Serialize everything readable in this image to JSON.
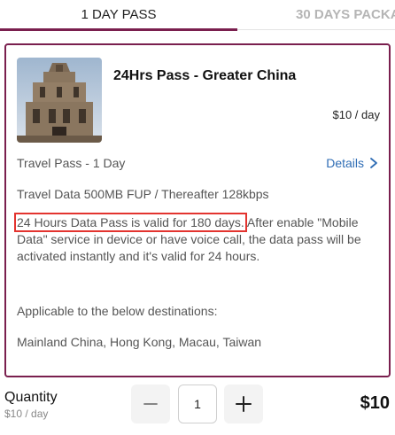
{
  "tabs": [
    {
      "label": "1 DAY PASS"
    },
    {
      "label": "30 DAYS PACKA"
    }
  ],
  "card": {
    "title": "24Hrs Pass - Greater China",
    "price_per_day": "$10 / day",
    "pass_type": "Travel Pass - 1 Day",
    "details_label": "Details",
    "data_line": "Travel Data 500MB FUP / Thereafter 128kbps",
    "validity_highlight": "24 Hours Data Pass is valid for 180 days.",
    "validity_rest": " After enable \"Mobile Data\" service in device or have voice call, the data pass will be activated instantly and it's valid for 24 hours.",
    "applicable": "Applicable to the below destinations:",
    "destinations": "Mainland China, Hong Kong, Macau, Taiwan",
    "image_icon": "ruins-st-paul-photo"
  },
  "footer": {
    "quantity_label": "Quantity",
    "quantity_sub": "$10 / day",
    "quantity_value": "1",
    "total": "$10"
  },
  "colors": {
    "accent": "#7a1f4e",
    "link": "#2f6db5",
    "highlight_box": "#e3342f"
  }
}
